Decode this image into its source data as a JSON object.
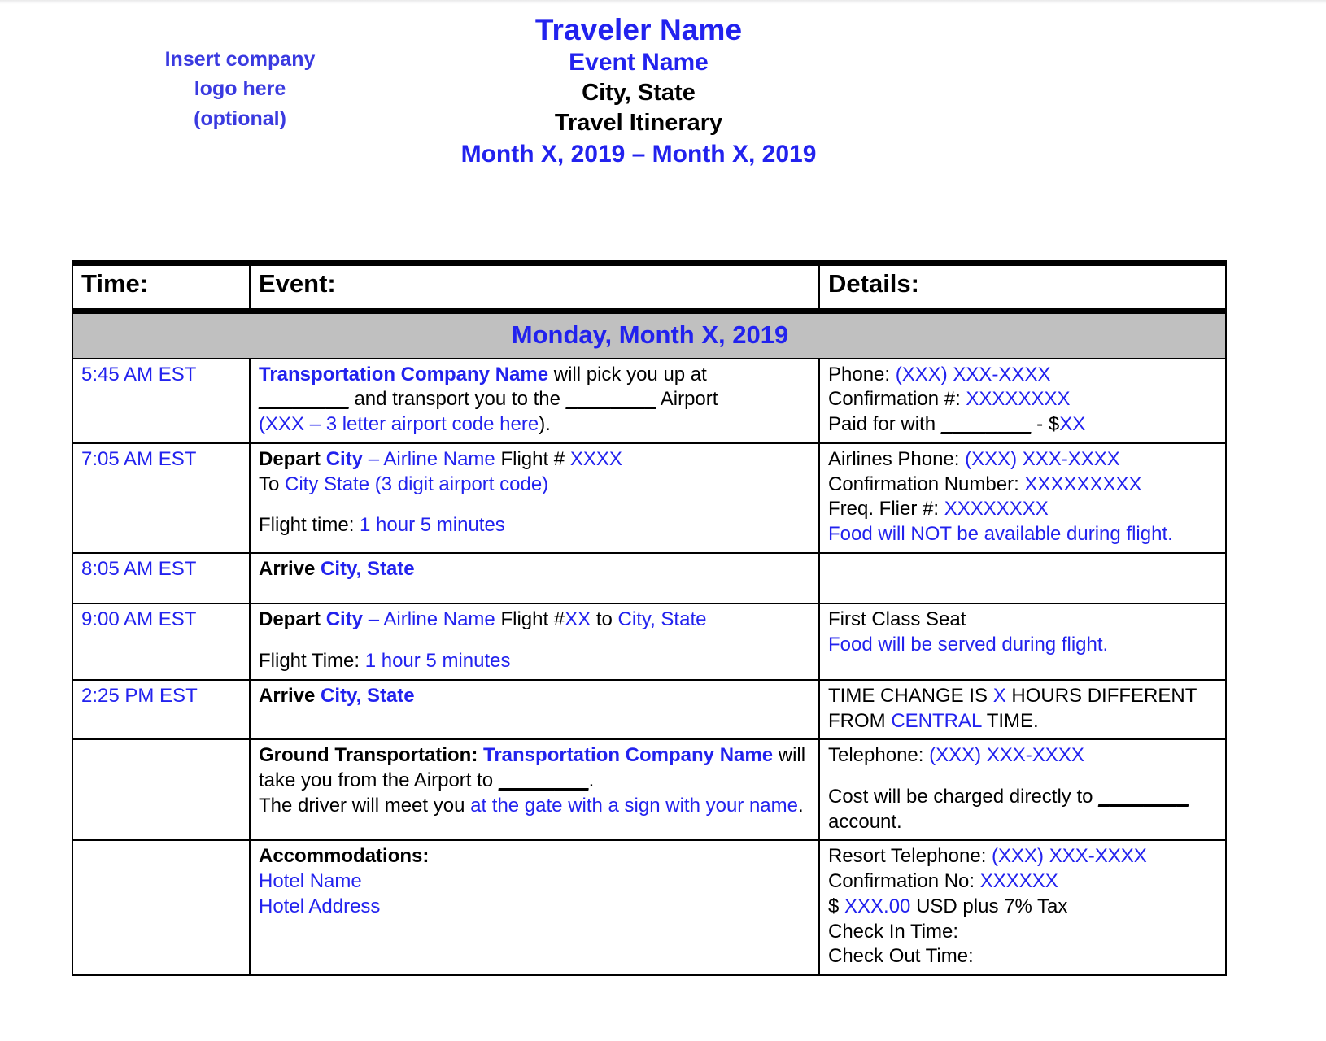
{
  "logo": {
    "line1": "Insert company",
    "line2": "logo here",
    "line3": "(optional)"
  },
  "header": {
    "traveler_name": "Traveler Name",
    "event_name": "Event Name",
    "city_state": "City, State",
    "doc_title": "Travel Itinerary",
    "date_range": "Month X, 2019 – Month X, 2019"
  },
  "table": {
    "columns": {
      "time": "Time:",
      "event": "Event:",
      "details": "Details:"
    },
    "day_banner": "Monday, Month X, 2019",
    "rows": [
      {
        "time": "5:45 AM EST",
        "event": {
          "l1_company": "Transportation Company Name",
          "l1_rest": " will pick you up at",
          "l2_a": " and transport you to the ",
          "l2_b": " Airport",
          "l3_open": "(",
          "l3_code": "XXX – 3 letter airport code here",
          "l3_close": ")."
        },
        "details": {
          "phone_label": "Phone: ",
          "phone_value": "(XXX) XXX-XXXX",
          "conf_label": "Confirmation #: ",
          "conf_value": "XXXXXXXX",
          "paid_label": "Paid for with ",
          "paid_mid": " - $",
          "paid_amount": "XX"
        }
      },
      {
        "time": "7:05 AM EST",
        "event": {
          "depart": "Depart ",
          "city": "City",
          "airline": " – Airline Name",
          "flight_label": " Flight # ",
          "flight_no": "XXXX",
          "to_label": "To ",
          "to_city": "City State (3 digit airport code)",
          "ftime_label": "Flight time: ",
          "ftime_value": "1 hour 5 minutes"
        },
        "details": {
          "airline_phone_label": "Airlines Phone: ",
          "airline_phone_value": "(XXX) XXX-XXXX",
          "conf_label": "Confirmation Number: ",
          "conf_value": "XXXXXXXXX",
          "ff_label": "Freq. Flier #: ",
          "ff_value": "XXXXXXXX",
          "food_note": "Food will NOT be available during flight."
        }
      },
      {
        "time": "8:05 AM EST",
        "event": {
          "arrive": "Arrive ",
          "city_state": "City, State"
        },
        "details": {}
      },
      {
        "time": "9:00 AM EST",
        "event": {
          "depart": "Depart ",
          "city": "City",
          "airline": " – Airline Name",
          "flight_label": " Flight #",
          "flight_no": "XX",
          "to_label": " to ",
          "to_city": "City, State",
          "ftime_label": "Flight Time: ",
          "ftime_value": "1 hour 5 minutes"
        },
        "details": {
          "seat": "First Class Seat",
          "food_note": "Food will be served during flight."
        }
      },
      {
        "time": "2:25 PM EST",
        "event": {
          "arrive": "Arrive ",
          "city_state": "City, State"
        },
        "details": {
          "tc_a": "TIME CHANGE IS ",
          "tc_x": "X",
          "tc_b": " HOURS DIFFERENT FROM ",
          "tc_zone": "CENTRAL",
          "tc_c": " TIME."
        }
      },
      {
        "time": "",
        "event": {
          "gt_label": "Ground Transportation:  ",
          "gt_company": "Transportation Company Name",
          "gt_rest": " will take you  from the Airport to ",
          "gt_period": ".",
          "driver_a": "The driver will meet you ",
          "driver_b": "at the gate with a sign with your name",
          "driver_c": "."
        },
        "details": {
          "tel_label": "Telephone:  ",
          "tel_value": "(XXX) XXX-XXXX",
          "cost_a": "Cost will be charged directly to ",
          "cost_b": "account."
        }
      },
      {
        "time": "",
        "event": {
          "acc_label": "Accommodations:",
          "hotel_name": "Hotel Name",
          "hotel_address": "Hotel Address"
        },
        "details": {
          "resort_tel_label": "Resort Telephone:  ",
          "resort_tel_value": "(XXX) XXX-XXXX",
          "conf_label": "Confirmation No:  ",
          "conf_value": "XXXXXX",
          "price_a": "$ ",
          "price_value": "XXX.00",
          "price_b": " USD plus 7% Tax",
          "check_in": "Check In Time:",
          "check_out": "Check Out Time:"
        }
      }
    ]
  },
  "colors": {
    "accent_blue": "#2222EE",
    "logo_blue": "#3A3AE0",
    "day_banner_gray": "#C0C0C0",
    "text_black": "#000000"
  }
}
